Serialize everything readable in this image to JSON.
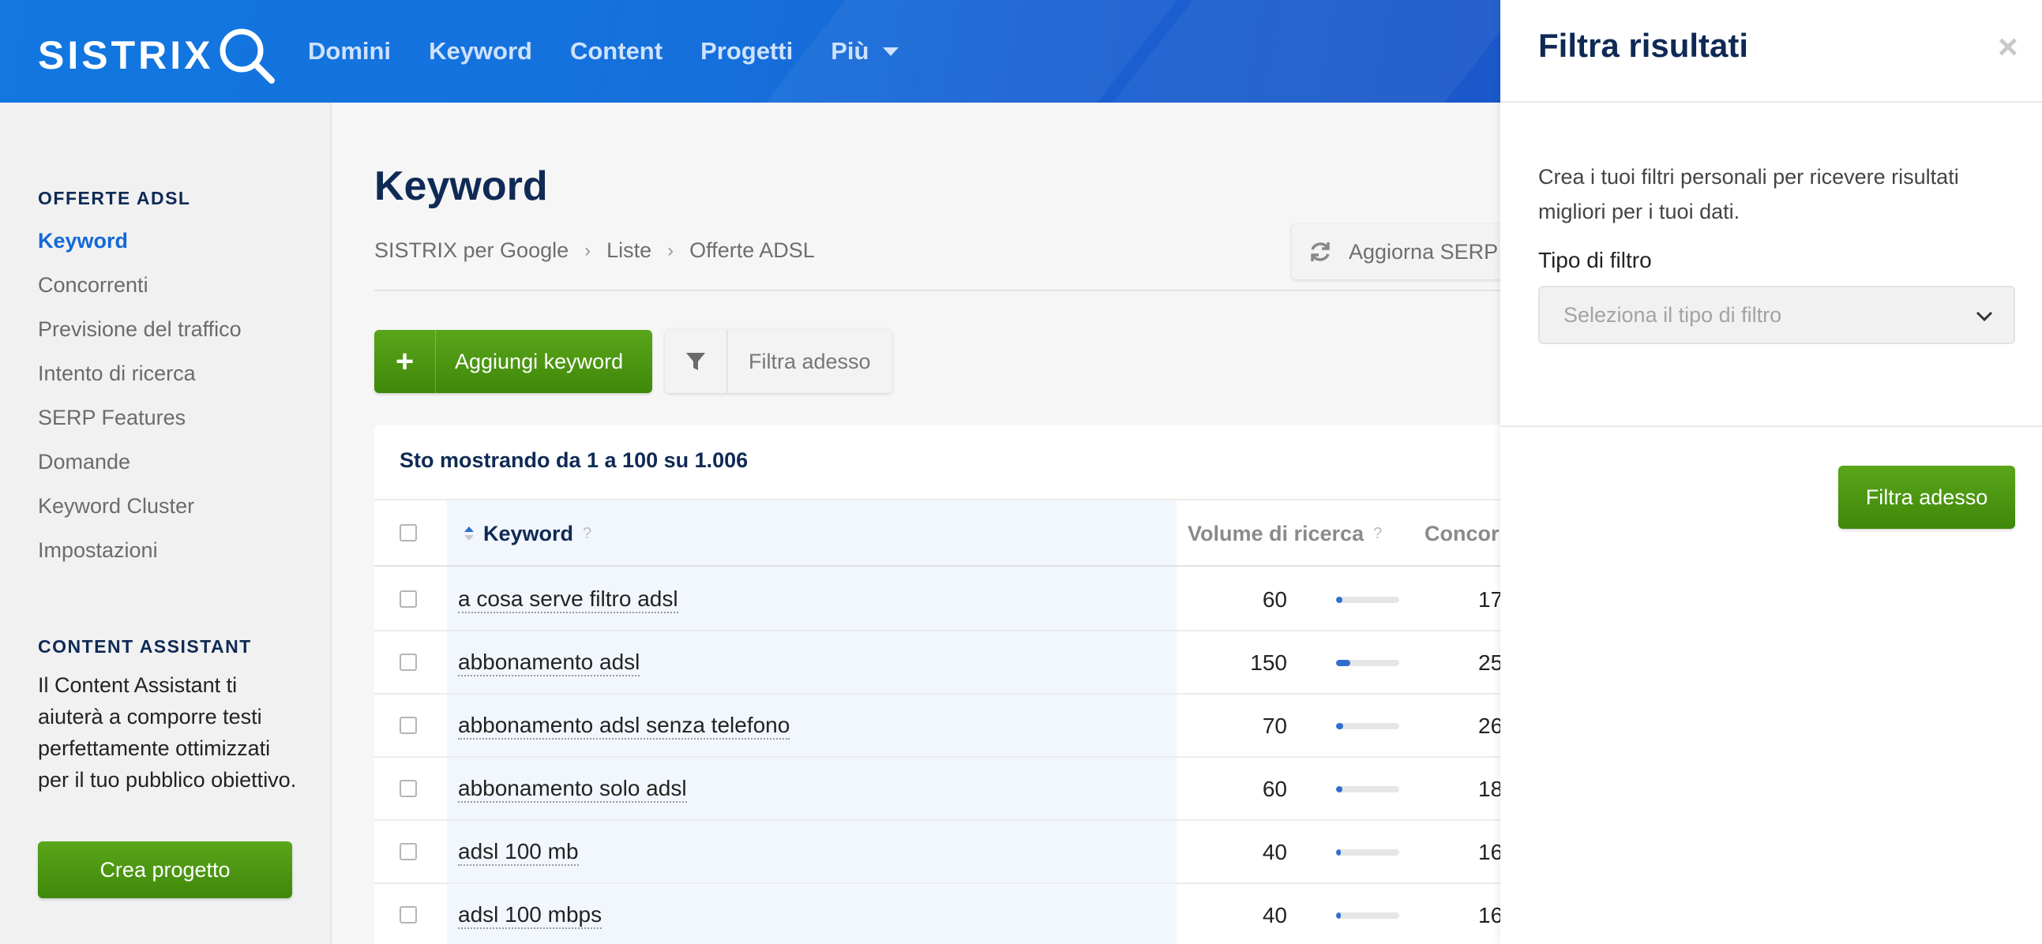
{
  "header": {
    "logo_text": "SISTRIX",
    "nav": [
      {
        "label": "Domini"
      },
      {
        "label": "Keyword"
      },
      {
        "label": "Content"
      },
      {
        "label": "Progetti"
      },
      {
        "label": "Più"
      }
    ]
  },
  "sidebar": {
    "section1_heading": "OFFERTE ADSL",
    "items": [
      {
        "label": "Keyword",
        "active": true
      },
      {
        "label": "Concorrenti"
      },
      {
        "label": "Previsione del traffico"
      },
      {
        "label": "Intento di ricerca"
      },
      {
        "label": "SERP Features"
      },
      {
        "label": "Domande"
      },
      {
        "label": "Keyword Cluster"
      },
      {
        "label": "Impostazioni"
      }
    ],
    "section2_heading": "CONTENT ASSISTANT",
    "section2_text": "Il Content Assistant ti aiuterà a comporre testi perfettamente ottimizzati per il tuo pubblico obiettivo.",
    "section2_button": "Crea progetto"
  },
  "main": {
    "title": "Keyword",
    "breadcrumb": [
      "SISTRIX per Google",
      "Liste",
      "Offerte ADSL"
    ],
    "refresh_label": "Aggiorna SERP",
    "add_button": "Aggiungi keyword",
    "filter_button": "Filtra adesso",
    "showing": "Sto mostrando da 1 a 100 su 1.006",
    "columns": {
      "keyword": "Keyword",
      "volume": "Volume di ricerca",
      "competition": "Concorr",
      "help": "?"
    },
    "rows": [
      {
        "keyword": "a cosa serve filtro adsl",
        "volume": "60",
        "volume_fraction": 0.1,
        "competition": "17"
      },
      {
        "keyword": "abbonamento adsl",
        "volume": "150",
        "volume_fraction": 0.22,
        "competition": "25"
      },
      {
        "keyword": "abbonamento adsl senza telefono",
        "volume": "70",
        "volume_fraction": 0.11,
        "competition": "26"
      },
      {
        "keyword": "abbonamento solo adsl",
        "volume": "60",
        "volume_fraction": 0.1,
        "competition": "18"
      },
      {
        "keyword": "adsl 100 mb",
        "volume": "40",
        "volume_fraction": 0.07,
        "competition": "16"
      },
      {
        "keyword": "adsl 100 mbps",
        "volume": "40",
        "volume_fraction": 0.07,
        "competition": "16"
      }
    ]
  },
  "panel": {
    "title": "Filtra risultati",
    "close": "×",
    "description": "Crea i tuoi filtri personali per ricevere risultati migliori per i tuoi dati.",
    "filter_type_label": "Tipo di filtro",
    "filter_type_placeholder": "Seleziona il tipo di filtro",
    "apply_button": "Filtra adesso"
  },
  "colors": {
    "brand_blue": "#1570dc",
    "navy": "#0f2a55",
    "green": "#4a9612",
    "link_blue": "#1368d8"
  }
}
